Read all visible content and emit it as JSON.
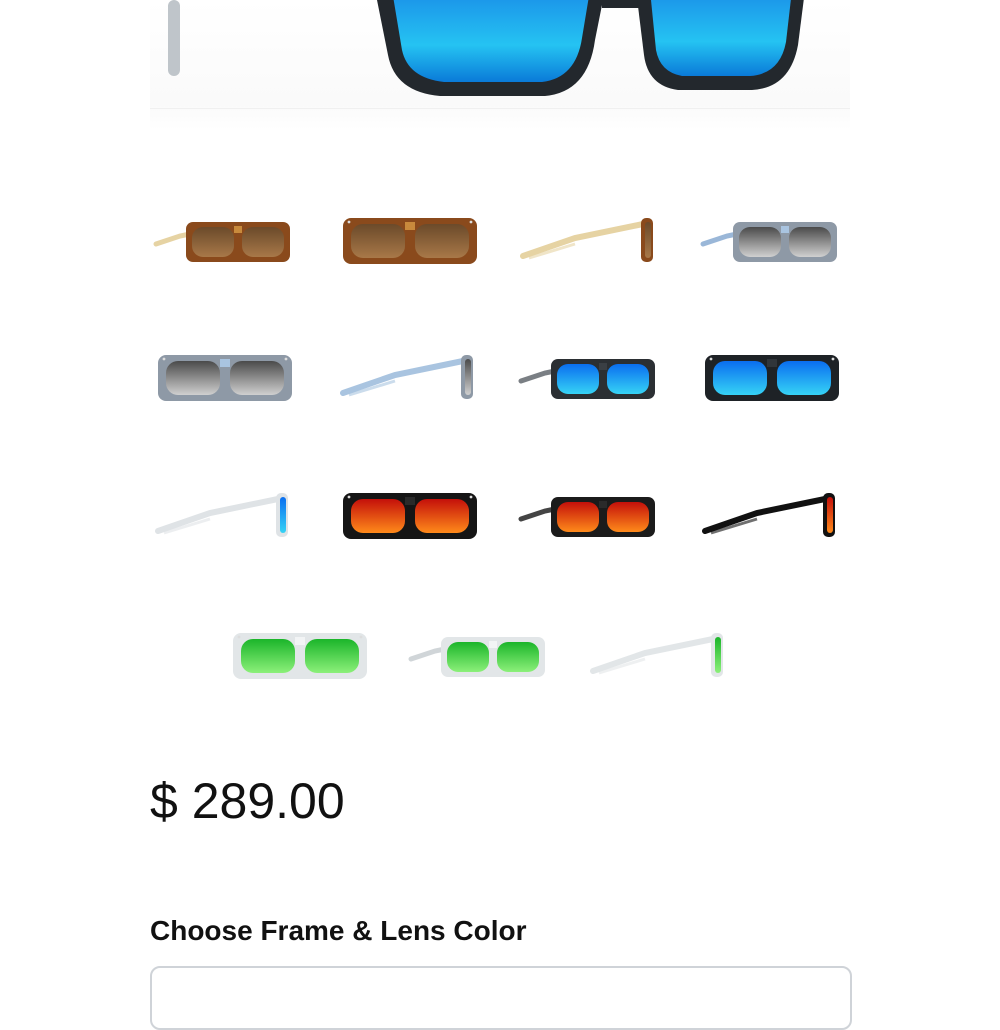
{
  "hero": {
    "image": "sunglasses-front-blue-hawaii-lens"
  },
  "thumbnails": [
    {
      "name": "thumb-tortoise-three-quarter",
      "frame": "#8a4a1c",
      "frame2": "#c88a3c",
      "temple": "#e6d3a3",
      "lens": "#6b4a2a",
      "lens2": "#a87848",
      "view": "three-quarter"
    },
    {
      "name": "thumb-tortoise-front",
      "frame": "#8a4a1c",
      "frame2": "#c88a3c",
      "temple": "#8a4a1c",
      "lens": "#6b4a2a",
      "lens2": "#a87848",
      "view": "front"
    },
    {
      "name": "thumb-tortoise-side",
      "frame": "#8a4a1c",
      "frame2": "#c88a3c",
      "temple": "#e6d3a3",
      "lens": "#6b4a2a",
      "lens2": "#a87848",
      "view": "side"
    },
    {
      "name": "thumb-grey-blue-three-quarter",
      "frame": "#8e99a6",
      "frame2": "#a9c4e0",
      "temple": "#9ab7d8",
      "lens": "#4a4a4a",
      "lens2": "#d0d0d0",
      "view": "three-quarter"
    },
    {
      "name": "thumb-grey-blue-front",
      "frame": "#8e99a6",
      "frame2": "#a9c4e0",
      "temple": "#8e99a6",
      "lens": "#4a4a4a",
      "lens2": "#d0d0d0",
      "view": "front"
    },
    {
      "name": "thumb-grey-blue-side",
      "frame": "#8e99a6",
      "frame2": "#a9c4e0",
      "temple": "#a9c4e0",
      "lens": "#4a4a4a",
      "lens2": "#d0d0d0",
      "view": "side"
    },
    {
      "name": "thumb-black-blue-three-quarter",
      "frame": "#2b2f33",
      "frame2": "#3a3f44",
      "temple": "#7a7f84",
      "lens": "#0a6ef0",
      "lens2": "#36d3f5",
      "view": "three-quarter"
    },
    {
      "name": "thumb-black-blue-front",
      "frame": "#1e2226",
      "frame2": "#30353a",
      "temple": "#1e2226",
      "lens": "#0a6ef0",
      "lens2": "#36d3f5",
      "view": "front"
    },
    {
      "name": "thumb-clear-blue-side",
      "frame": "#dfe3e6",
      "frame2": "#eef0f2",
      "temple": "#dfe3e6",
      "lens": "#0a6ef0",
      "lens2": "#36d3f5",
      "view": "side"
    },
    {
      "name": "thumb-black-red-front",
      "frame": "#151515",
      "frame2": "#2a2a2a",
      "temple": "#151515",
      "lens": "#c4100a",
      "lens2": "#ff8a1a",
      "view": "front"
    },
    {
      "name": "thumb-black-red-three-quarter",
      "frame": "#1b1b1b",
      "frame2": "#2a2a2a",
      "temple": "#444444",
      "lens": "#c4100a",
      "lens2": "#ff8a1a",
      "view": "three-quarter"
    },
    {
      "name": "thumb-black-red-side",
      "frame": "#111111",
      "frame2": "#222222",
      "temple": "#111111",
      "lens": "#c4100a",
      "lens2": "#ff8a1a",
      "view": "side"
    },
    {
      "name": "thumb-clear-green-front",
      "frame": "#e2e6e8",
      "frame2": "#f2f4f5",
      "temple": "#e2e6e8",
      "lens": "#1bb52a",
      "lens2": "#8cf07a",
      "view": "front"
    },
    {
      "name": "thumb-clear-green-three-quarter",
      "frame": "#e2e6e8",
      "frame2": "#f2f4f5",
      "temple": "#d0d5d8",
      "lens": "#1bb52a",
      "lens2": "#8cf07a",
      "view": "three-quarter"
    },
    {
      "name": "thumb-clear-green-side",
      "frame": "#e2e6e8",
      "frame2": "#f2f4f5",
      "temple": "#e2e6e8",
      "lens": "#1bb52a",
      "lens2": "#8cf07a",
      "view": "side"
    }
  ],
  "price": "$ 289.00",
  "choose_label": "Choose Frame & Lens Color",
  "colors": {
    "text": "#111111",
    "border": "#cfd3d8"
  }
}
